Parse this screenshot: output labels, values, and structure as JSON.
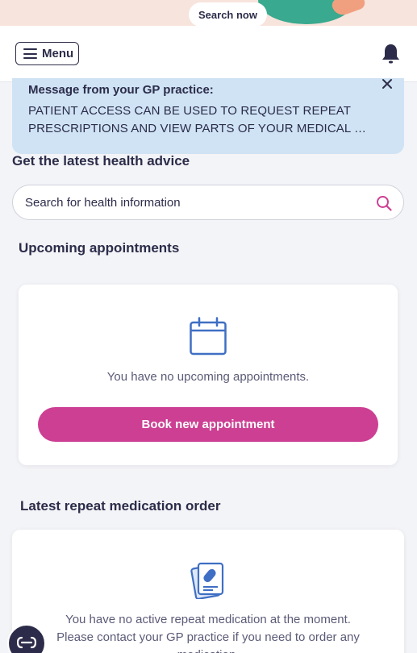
{
  "promo": {
    "search_now_label": "Search now"
  },
  "header": {
    "menu_label": "Menu",
    "notification_icon": "bell-icon"
  },
  "gp_message": {
    "title": "Message from your GP practice:",
    "line1": "PATIENT ACCESS CAN BE USED TO REQUEST REPEAT",
    "line2": "PRESCRIPTIONS AND VIEW PARTS OF YOUR MEDICAL …",
    "close_icon": "close-icon"
  },
  "health_advice": {
    "heading": "Get the latest health advice",
    "search_placeholder": "Search for health information",
    "search_icon": "search-icon"
  },
  "appointments": {
    "heading": "Upcoming appointments",
    "empty_text": "You have no upcoming appointments.",
    "book_label": "Book new appointment",
    "icon": "calendar-icon"
  },
  "medication": {
    "heading": "Latest repeat medication order",
    "line1": "You have no active repeat medication at the moment.",
    "line2": "Please contact your GP practice if you need to order any",
    "line3": "medication.",
    "icon": "prescription-icon"
  },
  "colors": {
    "brand_pink": "#cc3f93",
    "icon_blue": "#3f6fc4",
    "message_bg": "#cfe3f4",
    "text_dark": "#2c2c4a"
  }
}
